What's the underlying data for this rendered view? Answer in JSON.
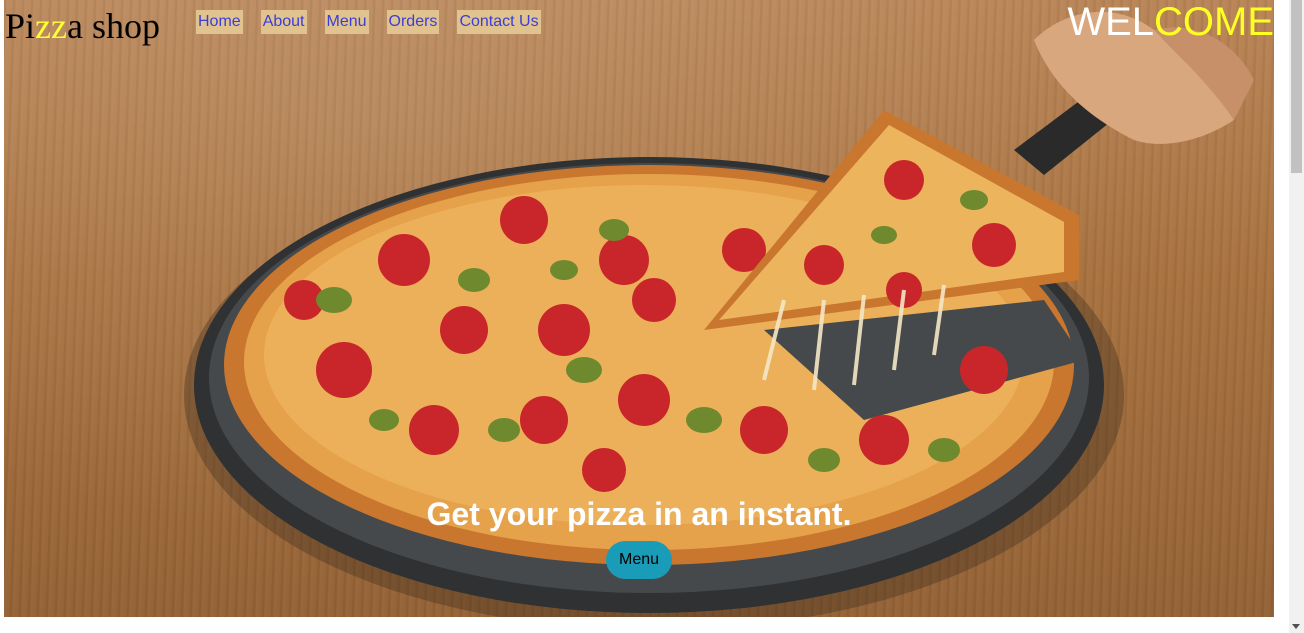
{
  "header": {
    "logo": {
      "part1": "Pi",
      "accent": "zz",
      "part2": "a shop"
    },
    "welcome": {
      "part1": "WEL",
      "accent": "COME"
    }
  },
  "nav": {
    "items": [
      {
        "label": "Home"
      },
      {
        "label": "About"
      },
      {
        "label": "Menu"
      },
      {
        "label": "Orders"
      },
      {
        "label": "Contact Us"
      }
    ]
  },
  "hero": {
    "tagline": "Get your pizza in an instant.",
    "button_label": "Menu"
  },
  "colors": {
    "logo_accent": "#ffff33",
    "nav_background": "#e0c38f",
    "nav_link": "#3d3dd8",
    "button_background": "#1a9bb8"
  },
  "icons": {
    "scroll_down": "chevron-down-icon"
  }
}
